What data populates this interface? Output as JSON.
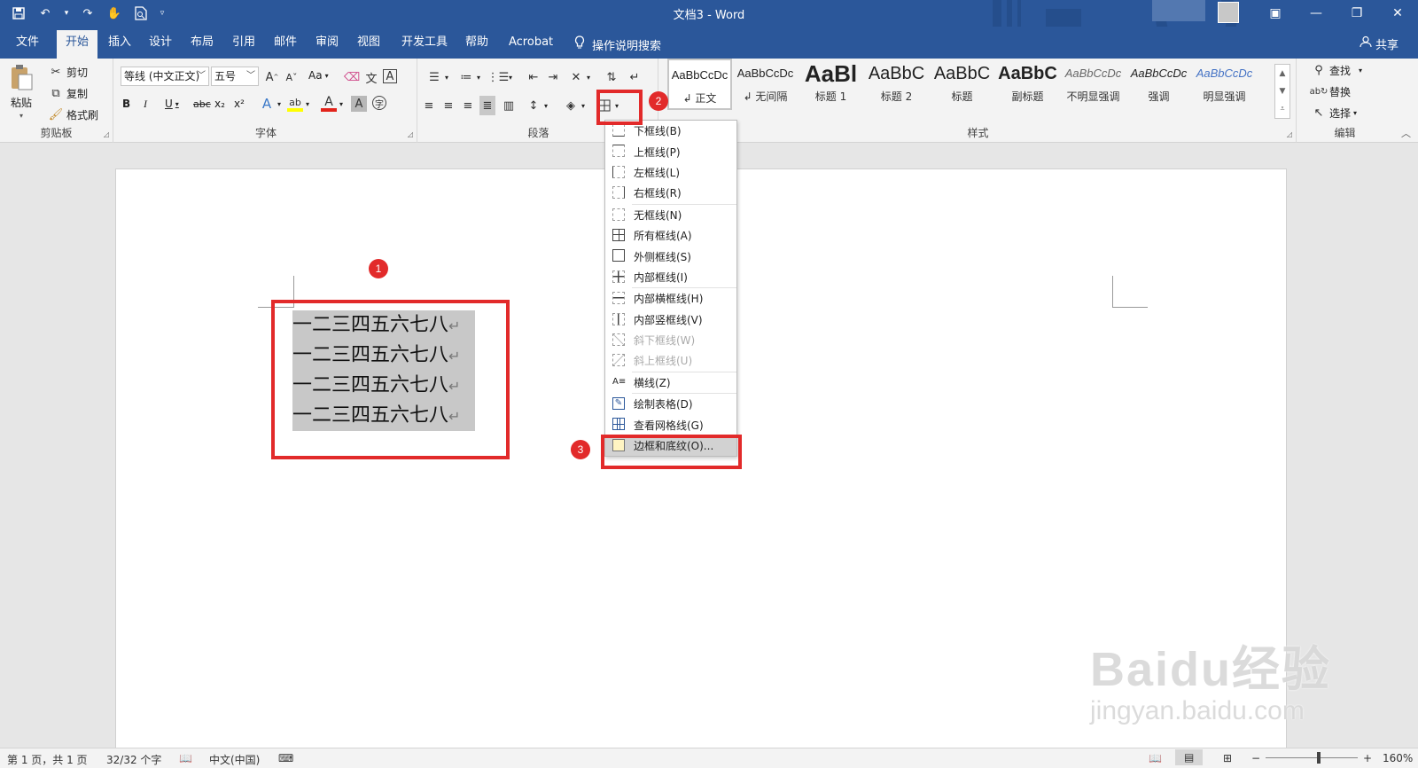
{
  "window": {
    "title": "文档3 - Word",
    "qat": [
      "save-icon",
      "undo-icon",
      "redo-icon",
      "touch-mode-icon",
      "print-preview-icon",
      "customize-qat-icon"
    ],
    "controls": [
      "ribbon-display-icon",
      "minimize-icon",
      "restore-icon",
      "close-icon"
    ]
  },
  "tabs": {
    "items": [
      "文件",
      "开始",
      "插入",
      "设计",
      "布局",
      "引用",
      "邮件",
      "审阅",
      "视图",
      "开发工具",
      "帮助",
      "Acrobat"
    ],
    "active": "开始",
    "tell_me": "操作说明搜索",
    "share": "共享"
  },
  "clipboard": {
    "paste": "粘贴",
    "cut": "剪切",
    "copy": "复制",
    "format_painter": "格式刷",
    "label": "剪贴板"
  },
  "font": {
    "name": "等线 (中文正文)",
    "size": "五号",
    "change_case": "Aa",
    "bold": "B",
    "italic": "I",
    "underline": "U",
    "strike": "abc",
    "sub": "x₂",
    "sup": "x²",
    "label": "字体"
  },
  "paragraph": {
    "label": "段落"
  },
  "styles": {
    "items": [
      {
        "sample": "AaBbCcDc",
        "name": "↲ 正文"
      },
      {
        "sample": "AaBbCcDc",
        "name": "↲ 无间隔"
      },
      {
        "sample": "AaBl",
        "name": "标题 1"
      },
      {
        "sample": "AaBbC",
        "name": "标题 2"
      },
      {
        "sample": "AaBbC",
        "name": "标题"
      },
      {
        "sample": "AaBbC",
        "name": "副标题"
      },
      {
        "sample": "AaBbCcDc",
        "name": "不明显强调"
      },
      {
        "sample": "AaBbCcDc",
        "name": "强调"
      },
      {
        "sample": "AaBbCcDc",
        "name": "明显强调"
      }
    ],
    "label": "样式"
  },
  "editing": {
    "find": "查找",
    "replace": "替换",
    "select": "选择",
    "label": "编辑"
  },
  "document": {
    "lines": [
      "一二三四五六七八",
      "一二三四五六七八",
      "一二三四五六七八",
      "一二三四五六七八"
    ],
    "return_mark": "↵"
  },
  "border_menu": {
    "items": [
      {
        "label": "下框线(B)",
        "icon": "bottom-border-icon",
        "disabled": false
      },
      {
        "label": "上框线(P)",
        "icon": "top-border-icon",
        "disabled": false
      },
      {
        "label": "左框线(L)",
        "icon": "left-border-icon",
        "disabled": false
      },
      {
        "label": "右框线(R)",
        "icon": "right-border-icon",
        "disabled": false
      },
      {
        "label": "无框线(N)",
        "icon": "no-border-icon",
        "disabled": false
      },
      {
        "label": "所有框线(A)",
        "icon": "all-borders-icon",
        "disabled": false
      },
      {
        "label": "外侧框线(S)",
        "icon": "outside-borders-icon",
        "disabled": false
      },
      {
        "label": "内部框线(I)",
        "icon": "inside-borders-icon",
        "disabled": false
      },
      {
        "label": "内部横框线(H)",
        "icon": "inside-horizontal-border-icon",
        "disabled": false
      },
      {
        "label": "内部竖框线(V)",
        "icon": "inside-vertical-border-icon",
        "disabled": false
      },
      {
        "label": "斜下框线(W)",
        "icon": "diagonal-down-border-icon",
        "disabled": true
      },
      {
        "label": "斜上框线(U)",
        "icon": "diagonal-up-border-icon",
        "disabled": true
      },
      {
        "label": "横线(Z)",
        "icon": "horizontal-line-icon",
        "disabled": false
      },
      {
        "label": "绘制表格(D)",
        "icon": "draw-table-icon",
        "disabled": false
      },
      {
        "label": "查看网格线(G)",
        "icon": "view-gridlines-icon",
        "disabled": false
      },
      {
        "label": "边框和底纹(O)...",
        "icon": "borders-shading-icon",
        "disabled": false
      }
    ],
    "highlighted": "边框和底纹(O)..."
  },
  "annotations": {
    "badges": [
      "1",
      "2",
      "3"
    ],
    "color": "#e22a2a"
  },
  "status": {
    "page": "第 1 页，共 1 页",
    "words": "32/32 个字",
    "language": "中文(中国)",
    "zoom_minus": "−",
    "zoom_plus": "+",
    "zoom": "160%"
  },
  "watermark": {
    "main": "Baidu经验",
    "sub": "jingyan.baidu.com"
  },
  "colors": {
    "brand": "#2b579a",
    "ribbon": "#f3f3f3",
    "canvas": "#e6e6e6",
    "highlight": "#c8c8c8"
  }
}
